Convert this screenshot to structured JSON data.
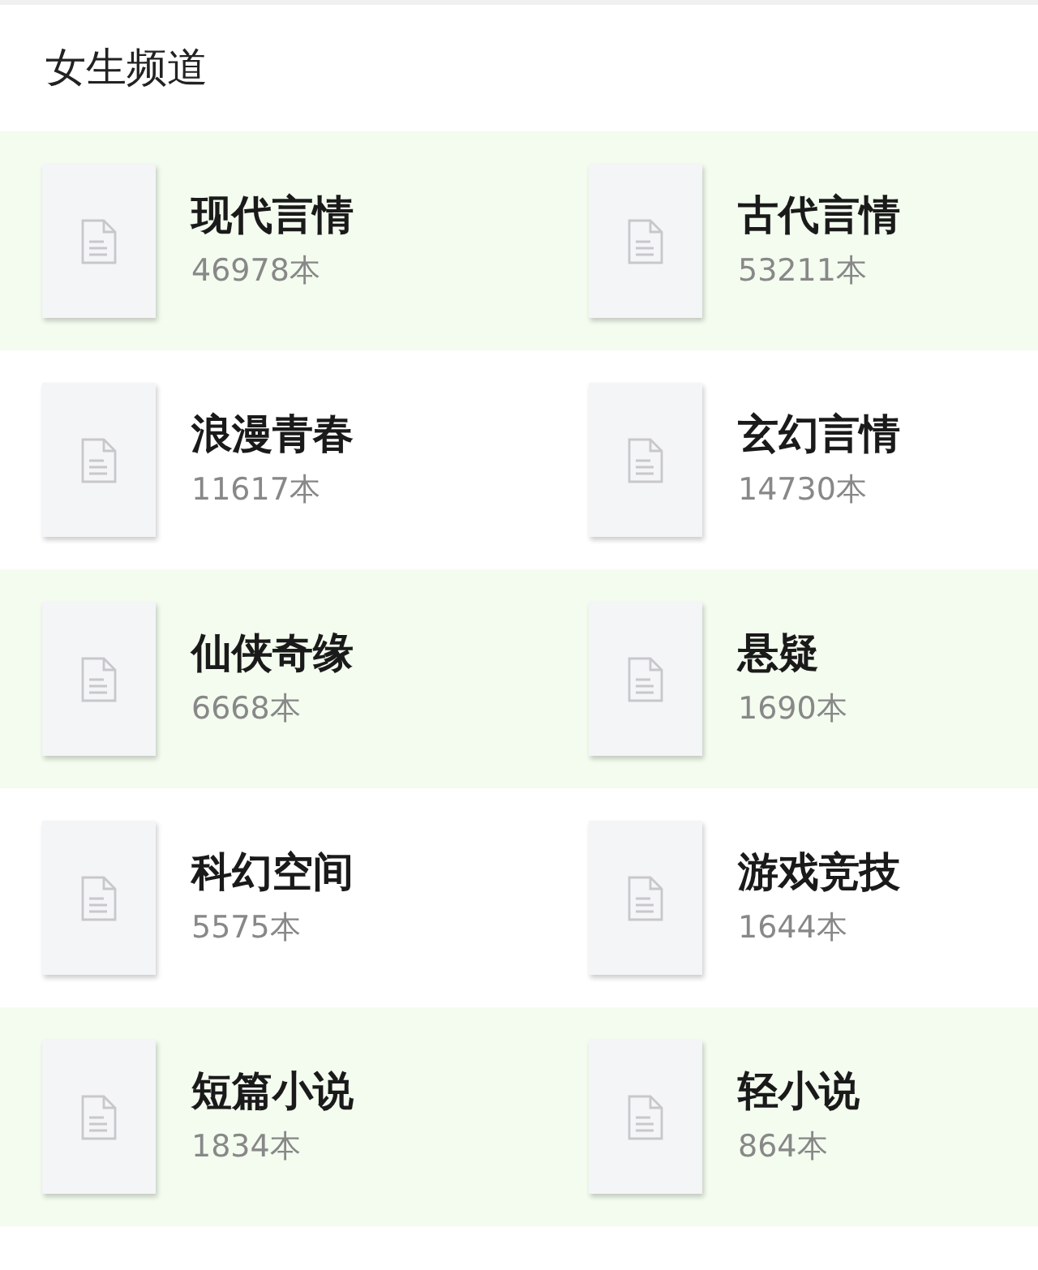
{
  "section_title": "女生频道",
  "categories": [
    {
      "name": "现代言情",
      "count": "46978本"
    },
    {
      "name": "古代言情",
      "count": "53211本"
    },
    {
      "name": "浪漫青春",
      "count": "11617本"
    },
    {
      "name": "玄幻言情",
      "count": "14730本"
    },
    {
      "name": "仙侠奇缘",
      "count": "6668本"
    },
    {
      "name": "悬疑",
      "count": "1690本"
    },
    {
      "name": "科幻空间",
      "count": "5575本"
    },
    {
      "name": "游戏竞技",
      "count": "1644本"
    },
    {
      "name": "短篇小说",
      "count": "1834本"
    },
    {
      "name": "轻小说",
      "count": "864本"
    }
  ]
}
